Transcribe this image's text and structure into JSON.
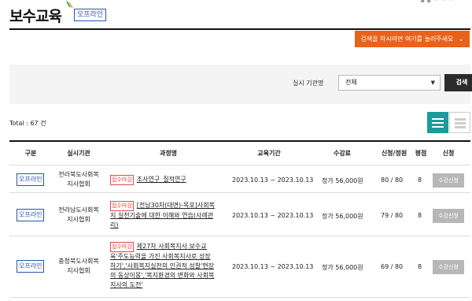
{
  "header": {
    "title": "보수교육",
    "badge": "오프라인",
    "top_util": "▪ ▪ ··· ··· ··"
  },
  "search_toggle": {
    "label": "검색을 하시려면 여기를 눌러주세요",
    "icon": "chevron-down-icon",
    "color": "#e9611a"
  },
  "filter": {
    "label": "실시 기관명",
    "selected": "전체",
    "button": "검색"
  },
  "total": "Total : 67 건",
  "view_toggle": {
    "active": "list",
    "accent": "#1a9c9a"
  },
  "table": {
    "headers": [
      "구분",
      "실시기관",
      "과정명",
      "교육기간",
      "수강료",
      "신청/정원",
      "평점",
      "신청"
    ],
    "rows": [
      {
        "type": "오프라인",
        "org_lines": [
          "전라북도사회복",
          "지사협회"
        ],
        "status": "접수마감",
        "course_lines": [
          "조사연구_질적연구"
        ],
        "period": "2023.10.13 ~ 2023.10.13",
        "fee": "정가 56,000원",
        "enrolled": "80 / 80",
        "rating": "8",
        "action": "수강신청"
      },
      {
        "type": "오프라인",
        "org_lines": [
          "전라남도사회복",
          "지사협회"
        ],
        "status": "접수마감",
        "course_lines": [
          "[전남30차(대면)-목포]사회복",
          "지 실천기술에 대한 이해와 연습(사례관",
          "리)"
        ],
        "period": "2023.10.13 ~ 2023.10.13",
        "fee": "정가 56,000원",
        "enrolled": "79 / 80",
        "rating": "8",
        "action": "수강신청"
      },
      {
        "type": "오프라인",
        "org_lines": [
          "충청북도사회복",
          "지사협회"
        ],
        "status": "접수마감",
        "course_lines": [
          "제27차 사회복지사 보수교",
          "육'주도능력을 가진 사회복지사로 성장",
          "하기','사회복지실천의 인권적 성찰'현장",
          "의 동상이몽','복지환경의 변화와 사회복",
          "지사의 도전'"
        ],
        "period": "2023.10.13 ~ 2023.10.13",
        "fee": "정가 56,000원",
        "enrolled": "69 / 80",
        "rating": "8",
        "action": "수강신청"
      }
    ]
  }
}
